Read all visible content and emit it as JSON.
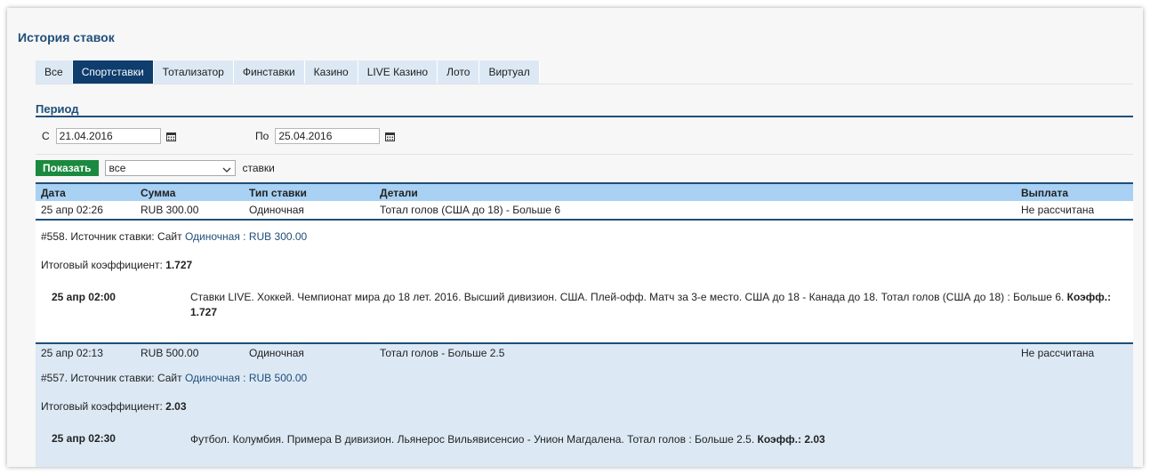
{
  "page": {
    "title": "История ставок"
  },
  "tabs": [
    "Все",
    "Спортставки",
    "Тотализатор",
    "Финставки",
    "Казино",
    "LIVE Казино",
    "Лото",
    "Виртуал"
  ],
  "active_tab_index": 1,
  "period": {
    "title": "Период",
    "from_label": "С",
    "from_value": "21.04.2016",
    "to_label": "По",
    "to_value": "25.04.2016"
  },
  "filter": {
    "show_button": "Показать",
    "select_value": "все",
    "suffix": "ставки"
  },
  "table": {
    "headers": {
      "date": "Дата",
      "amount": "Сумма",
      "type": "Тип ставки",
      "details": "Детали",
      "payout": "Выплата"
    },
    "rows": [
      {
        "date": "25 апр 02:26",
        "amount": "RUB 300.00",
        "type": "Одиночная",
        "details": "Тотал голов (США до 18) - Больше 6",
        "payout": "Не рассчитана",
        "info_prefix": "#558. Источник ставки: Сайт",
        "info_link": "Одиночная : RUB 300.00",
        "coef_label": "Итоговый коэффициент:",
        "coef_value": "1.727",
        "event_time": "25 апр 02:00",
        "event_desc": "Ставки LIVE. Хоккей. Чемпионат мира до 18 лет. 2016. Высший дивизион. США. Плей-офф. Матч за 3-е место. США до 18 - Канада до 18. Тотал голов (США до 18) : Больше 6.",
        "event_coef_label": "Коэфф.:",
        "event_coef_value": "1.727"
      },
      {
        "date": "25 апр 02:13",
        "amount": "RUB 500.00",
        "type": "Одиночная",
        "details": "Тотал голов - Больше 2.5",
        "payout": "Не рассчитана",
        "info_prefix": "#557. Источник ставки: Сайт",
        "info_link": "Одиночная : RUB 500.00",
        "coef_label": "Итоговый коэффициент:",
        "coef_value": "2.03",
        "event_time": "25 апр 02:30",
        "event_desc": "Футбол. Колумбия. Примера В дивизион. Льянерос Вильявисенсио - Унион Магдалена. Тотал голов : Больше 2.5.",
        "event_coef_label": "Коэфф.:",
        "event_coef_value": "2.03"
      }
    ]
  },
  "colors": {
    "accent": "#1f4e79",
    "tab_active": "#0e3d6e",
    "tab_bg": "#dce9f5",
    "header_bg": "#a8d1f3",
    "show_button": "#1b8a3f"
  },
  "icons": {
    "calendar": "calendar-icon",
    "select_chevron": "chevron-down-icon"
  }
}
